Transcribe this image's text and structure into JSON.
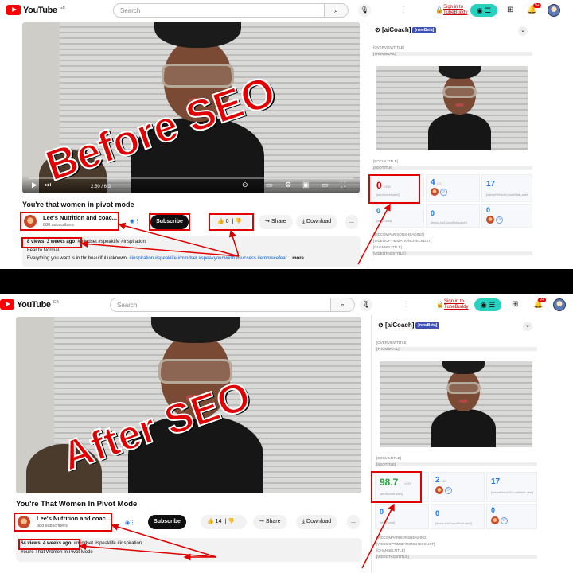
{
  "masthead": {
    "logo": "YouTube",
    "country": "GB",
    "search_placeholder": "Search",
    "search_icon": "search-icon",
    "mic_icon": "mic-icon",
    "sign_in_line1": "Sign in to",
    "sign_in_line2": "TubeBuddy",
    "notifications_badge": "9+"
  },
  "before": {
    "overlay": "Before SEO",
    "player": {
      "time": "2:50 / 6:3"
    },
    "title": "You're that women in pivot mode",
    "channel_name": "Lee's Nutrition and coac...",
    "subscribers": "888 subscribers",
    "subscribe_label": "Subscribe",
    "likes": "0",
    "share_label": "Share",
    "download_label": "Download",
    "more_actions": "...",
    "views": "8 views",
    "age": "3 weeks ago",
    "tags": "#mindset #speaklife #inspiration",
    "desc_line2": "Fear to Normal.",
    "desc_line3": "Everything you want is in thr boautiful unknown.",
    "desc_hashtags": "#inspiration #speaklife #mindset #speakyourworth #success #embracefear",
    "more_link": "...more"
  },
  "after": {
    "overlay": "After SEO",
    "title": "You're That Women In Pivot Mode",
    "channel_name": "Lee's Nutrition and coac...",
    "subscribers": "888 subscribers",
    "subscribe_label": "Subscribe",
    "likes": "14",
    "share_label": "Share",
    "download_label": "Download",
    "more_actions": "...",
    "views": "64 views",
    "age": "4 weeks ago",
    "tags": "#mindset #speaklife #inspiration",
    "desc_line2": "You're That Women In Pivot Mode"
  },
  "coach": {
    "header": "[aiCoach]",
    "beta": "[newBeta]",
    "overview_title": "[OVERVIEWTITLE]",
    "thumbnail": "[THUMBNAIL]",
    "social_title": "[SOCIALTITLE]",
    "seo_title": "[SEOTITLE]",
    "score_sub": "/100",
    "score_label": "[seoScoreLabel]",
    "comp_sub": "/10",
    "views_label": "[viewsPerUnitCountStatLabel]",
    "views_value": "17",
    "a_value": "0",
    "a_label": "[statCount]",
    "b_value": "0",
    "b_label": "[descLinkCountStatLabel]",
    "c_value": "0",
    "comparisons": "[VIDCOMPARISONSHEADING]",
    "checklist": "[VIDEOOPTIMIZATIONCHECKLIST]",
    "channel_title": "[CHANNELTITLE]",
    "video_tags": "[VIDEOTAGSTITLE]",
    "before_score": "0",
    "before_comp": "4",
    "after_score": "98.7",
    "after_comp": "2"
  },
  "colors": {
    "seo_red": "#e00000",
    "score_green": "#2e9e3e",
    "score_red": "#d00000",
    "views_blue": "#1a73e8"
  }
}
